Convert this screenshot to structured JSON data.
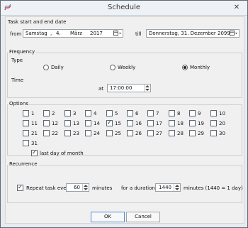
{
  "window": {
    "title": "Schedule",
    "close_glyph": "✕",
    "app_icon": "blue-wave-icon",
    "close_icon": "close-icon"
  },
  "task_dates": {
    "group_label": "Task start and end date",
    "from_label": "from",
    "start_weekday": "Samstag",
    "start_sep1": ",",
    "start_day": "4.",
    "start_month": "März",
    "start_year": "2017",
    "till_label": "till",
    "end_value": "Donnerstag, 31. Dezember 2099",
    "calendar_icon": "calendar-dropdown-icon"
  },
  "frequency": {
    "group_label": "Frequency",
    "type_label": "Type",
    "options": [
      "Daily",
      "Weekly",
      "Monthly"
    ],
    "selected": "Monthly",
    "time_label": "Time",
    "at_label": "at",
    "time_value": "17:00:00"
  },
  "options": {
    "group_label": "Options",
    "days": [
      "1",
      "2",
      "3",
      "4",
      "5",
      "6",
      "7",
      "8",
      "9",
      "10",
      "11",
      "12",
      "13",
      "14",
      "15",
      "16",
      "17",
      "18",
      "19",
      "20",
      "21",
      "22",
      "23",
      "24",
      "25",
      "26",
      "27",
      "28",
      "29",
      "30",
      "31"
    ],
    "checked_days": [
      "15"
    ],
    "last_day_label": "last day of month",
    "last_day_checked": true
  },
  "recurrence": {
    "group_label": "Recurrence",
    "repeat_label": "Repeat task every",
    "repeat_checked": true,
    "repeat_value": "60",
    "minutes_label": "minutes",
    "duration_label": "for a duration of",
    "duration_value": "1440",
    "duration_suffix": "minutes (1440 = 1 day)"
  },
  "buttons": {
    "ok": "OK",
    "cancel": "Cancel"
  }
}
